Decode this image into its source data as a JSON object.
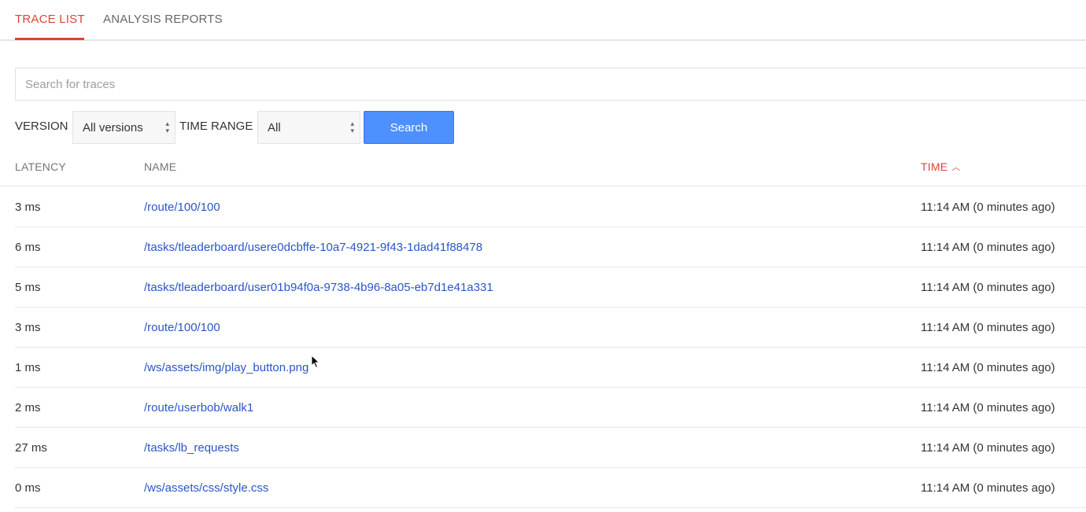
{
  "tabs": [
    {
      "label": "TRACE LIST",
      "active": true
    },
    {
      "label": "ANALYSIS REPORTS",
      "active": false
    }
  ],
  "search": {
    "placeholder": "Search for traces",
    "value": ""
  },
  "filters": {
    "version_label": "VERSION",
    "version_value": "All versions",
    "time_range_label": "TIME RANGE",
    "time_range_value": "All",
    "search_button": "Search"
  },
  "table": {
    "columns": {
      "latency": "LATENCY",
      "name": "NAME",
      "time": "TIME",
      "time_sort_icon": "chevron-up-icon"
    },
    "rows": [
      {
        "latency": "3 ms",
        "name": "/route/100/100",
        "time": "11:14 AM  (0 minutes ago)"
      },
      {
        "latency": "6 ms",
        "name": "/tasks/tleaderboard/usere0dcbffe-10a7-4921-9f43-1dad41f88478",
        "time": "11:14 AM  (0 minutes ago)"
      },
      {
        "latency": "5 ms",
        "name": "/tasks/tleaderboard/user01b94f0a-9738-4b96-8a05-eb7d1e41a331",
        "time": "11:14 AM  (0 minutes ago)"
      },
      {
        "latency": "3 ms",
        "name": "/route/100/100",
        "time": "11:14 AM  (0 minutes ago)"
      },
      {
        "latency": "1 ms",
        "name": "/ws/assets/img/play_button.png",
        "time": "11:14 AM  (0 minutes ago)"
      },
      {
        "latency": "2 ms",
        "name": "/route/userbob/walk1",
        "time": "11:14 AM  (0 minutes ago)"
      },
      {
        "latency": "27 ms",
        "name": "/tasks/lb_requests",
        "time": "11:14 AM  (0 minutes ago)"
      },
      {
        "latency": "0 ms",
        "name": "/ws/assets/css/style.css",
        "time": "11:14 AM  (0 minutes ago)"
      }
    ]
  },
  "colors": {
    "accent": "#db4437",
    "link": "#2a56c6",
    "button": "#4d90fe"
  }
}
